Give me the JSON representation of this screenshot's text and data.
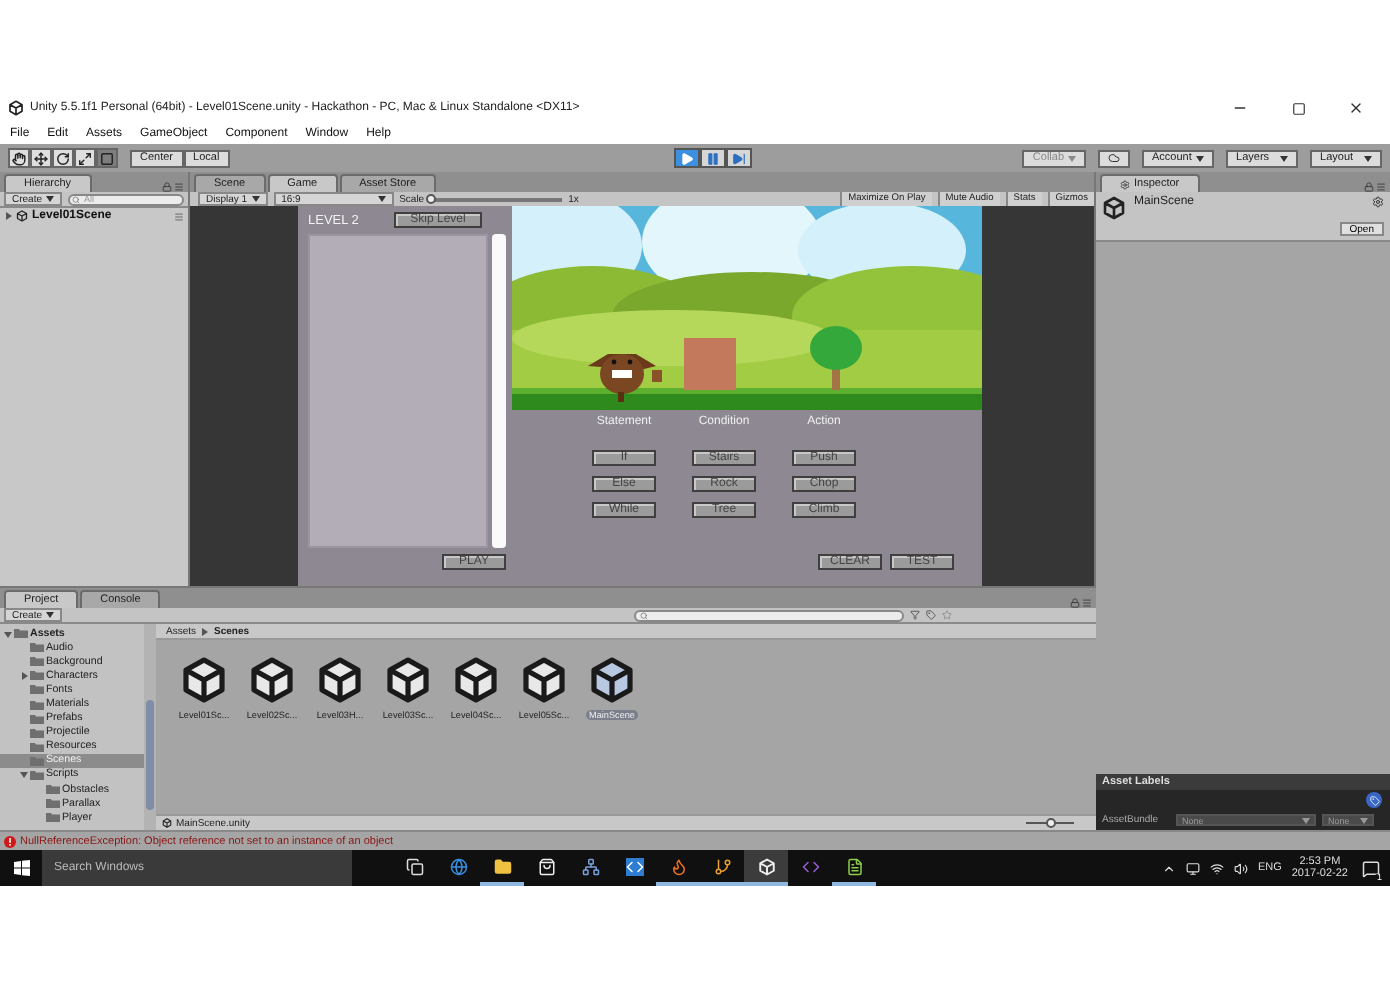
{
  "window": {
    "title": "Unity 5.5.1f1 Personal (64bit) - Level01Scene.unity - Hackathon - PC, Mac & Linux Standalone <DX11>"
  },
  "menu": [
    "File",
    "Edit",
    "Assets",
    "GameObject",
    "Component",
    "Window",
    "Help"
  ],
  "toolbar": {
    "tools": [
      {
        "kind": "hand",
        "selected": false
      },
      {
        "kind": "move",
        "selected": false
      },
      {
        "kind": "rotate",
        "selected": false
      },
      {
        "kind": "scale",
        "selected": false
      },
      {
        "kind": "rect",
        "selected": true
      }
    ],
    "pivot_mode": "Center",
    "pivot_rotation": "Local",
    "play_controls": [
      {
        "kind": "play",
        "on": true
      },
      {
        "kind": "pause",
        "on": false
      },
      {
        "kind": "step",
        "on": false
      }
    ],
    "collab": {
      "label": "Collab",
      "disabled": true
    },
    "account": "Account",
    "layers": "Layers",
    "layout": "Layout"
  },
  "hierarchy": {
    "title": "Hierarchy",
    "create": "Create",
    "search": {
      "placeholder": "All"
    },
    "items": [
      {
        "label": "Level01Scene",
        "expanded": false
      }
    ]
  },
  "game_view": {
    "tabs": [
      {
        "label": "Scene",
        "selected": false
      },
      {
        "label": "Game",
        "selected": true
      },
      {
        "label": "Asset Store",
        "selected": false
      }
    ],
    "display": "Display 1",
    "aspect": "16:9",
    "scale": {
      "label": "Scale",
      "level": 0,
      "value": "1x"
    },
    "toggles": [
      "Maximize On Play",
      "Mute Audio",
      "Stats",
      "Gizmos"
    ],
    "game": {
      "level_title": "LEVEL 2",
      "skip": "Skip Level",
      "play": "PLAY",
      "columns": [
        {
          "heading": "Statement",
          "buttons": [
            "If",
            "Else",
            "While"
          ]
        },
        {
          "heading": "Condition",
          "buttons": [
            "Stairs",
            "Rock",
            "Tree"
          ]
        },
        {
          "heading": "Action",
          "buttons": [
            "Push",
            "Chop",
            "Climb"
          ]
        }
      ],
      "clear": "CLEAR",
      "test": "TEST"
    }
  },
  "project": {
    "tabs": [
      {
        "label": "Project",
        "selected": true
      },
      {
        "label": "Console",
        "selected": false
      }
    ],
    "create": "Create",
    "tree": [
      {
        "label": "Assets",
        "expanded": true,
        "selected": false,
        "children": [
          {
            "label": "Audio",
            "selected": false
          },
          {
            "label": "Background",
            "selected": false
          },
          {
            "label": "Characters",
            "expanded": false,
            "selected": false
          },
          {
            "label": "Fonts",
            "selected": false
          },
          {
            "label": "Materials",
            "selected": false
          },
          {
            "label": "Prefabs",
            "selected": false
          },
          {
            "label": "Projectile",
            "selected": false
          },
          {
            "label": "Resources",
            "selected": false
          },
          {
            "label": "Scenes",
            "selected": true
          },
          {
            "label": "Scripts",
            "expanded": true,
            "selected": false,
            "children": [
              {
                "label": "Obstacles",
                "selected": false
              },
              {
                "label": "Parallax",
                "selected": false
              },
              {
                "label": "Player",
                "selected": false
              }
            ]
          }
        ]
      }
    ],
    "breadcrumb": [
      "Assets",
      "Scenes"
    ],
    "assets": [
      {
        "label": "Level01Sc...",
        "selected": false
      },
      {
        "label": "Level02Sc...",
        "selected": false
      },
      {
        "label": "Level03H...",
        "selected": false
      },
      {
        "label": "Level03Sc...",
        "selected": false
      },
      {
        "label": "Level04Sc...",
        "selected": false
      },
      {
        "label": "Level05Sc...",
        "selected": false
      },
      {
        "label": "MainScene",
        "selected": true
      }
    ],
    "footer": "MainScene.unity",
    "icon_size": {
      "level": 0.5
    }
  },
  "inspector": {
    "title": "Inspector",
    "asset": "MainScene",
    "open": "Open",
    "labels_title": "Asset Labels",
    "bundle_label": "AssetBundle",
    "bundle_values": [
      "None",
      "None"
    ]
  },
  "status_bar": {
    "kind": "error",
    "message": "NullReferenceException: Object reference not set to an instance of an object"
  },
  "taskbar": {
    "search": {
      "placeholder": "Search Windows"
    },
    "apps": [
      {
        "kind": "taskview",
        "running": false,
        "selected": false
      },
      {
        "kind": "browser",
        "running": false,
        "selected": false
      },
      {
        "kind": "folder",
        "running": true,
        "selected": false
      },
      {
        "kind": "store",
        "running": false,
        "selected": false
      },
      {
        "kind": "network",
        "running": false,
        "selected": false
      },
      {
        "kind": "code",
        "running": false,
        "selected": false
      },
      {
        "kind": "firefox",
        "running": true,
        "selected": false
      },
      {
        "kind": "git",
        "running": true,
        "selected": false
      },
      {
        "kind": "unity",
        "running": true,
        "selected": true
      },
      {
        "kind": "studio",
        "running": false,
        "selected": false
      },
      {
        "kind": "notepad",
        "running": true,
        "selected": false
      }
    ],
    "language": "ENG",
    "time": "2:53 PM",
    "date": "2017-02-22",
    "notifications": "1"
  }
}
